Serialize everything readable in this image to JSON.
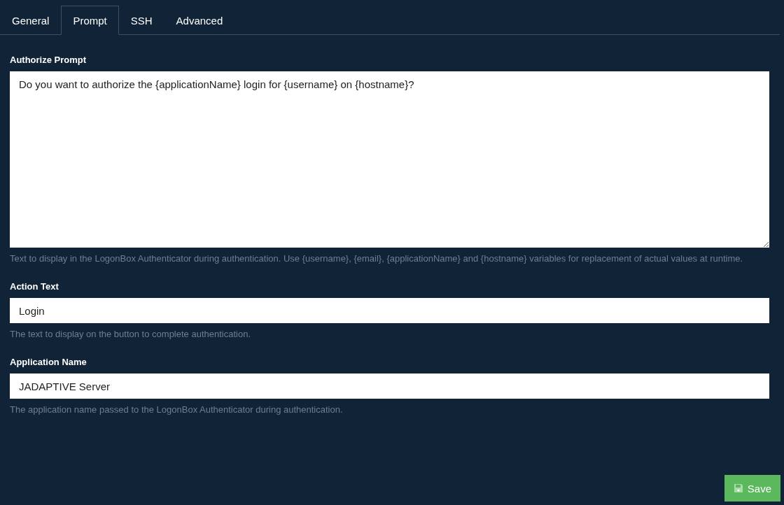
{
  "tabs": [
    {
      "label": "General",
      "selected": false
    },
    {
      "label": "Prompt",
      "selected": true
    },
    {
      "label": "SSH",
      "selected": false
    },
    {
      "label": "Advanced",
      "selected": false
    }
  ],
  "fields": [
    {
      "kind": "textarea",
      "label": "Authorize Prompt",
      "value": "Do you want to authorize the {applicationName} login for {username} on {hostname}?",
      "help": "Text to display in the LogonBox Authenticator during authentication. Use {username}, {email}, {applicationName} and {hostname} variables for replacement of actual values at runtime."
    },
    {
      "kind": "input",
      "label": "Action Text",
      "value": "Login",
      "help": "The text to display on the button to complete authentication."
    },
    {
      "kind": "input",
      "label": "Application Name",
      "value": "JADAPTIVE Server",
      "help": "The application name passed to the LogonBox Authenticator during authentication."
    }
  ],
  "save_button": {
    "label": "Save"
  }
}
